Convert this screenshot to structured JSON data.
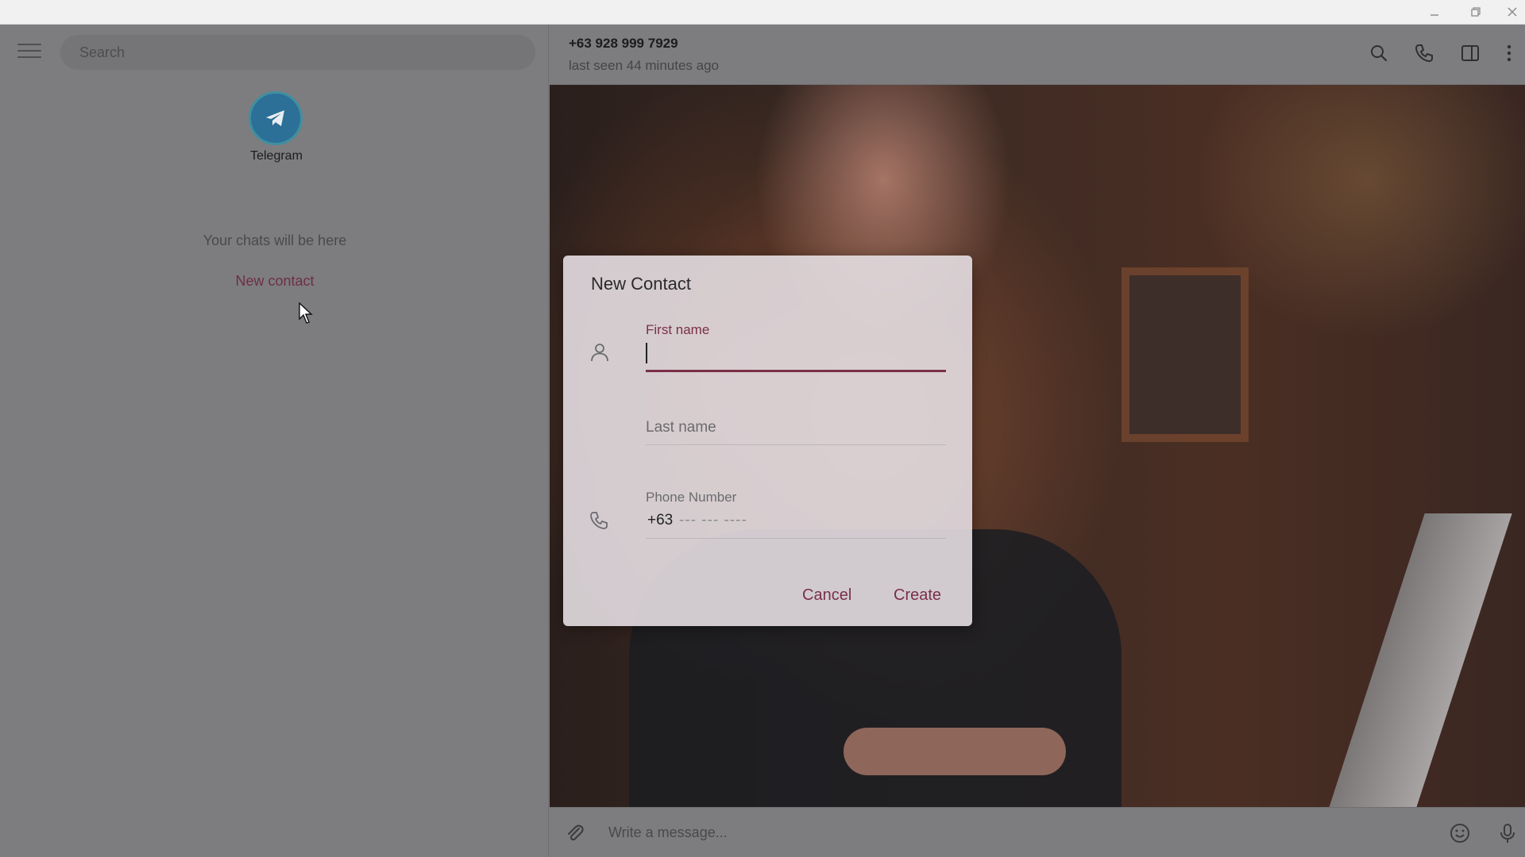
{
  "window": {
    "controls": [
      "minimize",
      "restore",
      "close"
    ]
  },
  "sidebar": {
    "search_placeholder": "Search",
    "app_name": "Telegram",
    "empty_text": "Your chats will be here",
    "new_contact_link": "New contact"
  },
  "chat": {
    "title": "+63 928 999 7929",
    "status": "last seen 44 minutes ago",
    "header_icons": [
      "search-icon",
      "phone-icon",
      "sidebar-toggle-icon",
      "more-vertical-icon"
    ],
    "composer_placeholder": "Write a message...",
    "composer_icons": [
      "attach-icon",
      "emoji-icon",
      "microphone-icon"
    ]
  },
  "modal": {
    "title": "New Contact",
    "first_name_label": "First name",
    "first_name_value": "",
    "last_name_placeholder": "Last name",
    "phone_label": "Phone Number",
    "phone_prefix": "+63",
    "phone_mask": "--- --- ----",
    "cancel_label": "Cancel",
    "create_label": "Create"
  },
  "colors": {
    "accent": "#7a2f48",
    "overlay": "#7d7d80",
    "telegram_blue": "#2c6f97"
  }
}
